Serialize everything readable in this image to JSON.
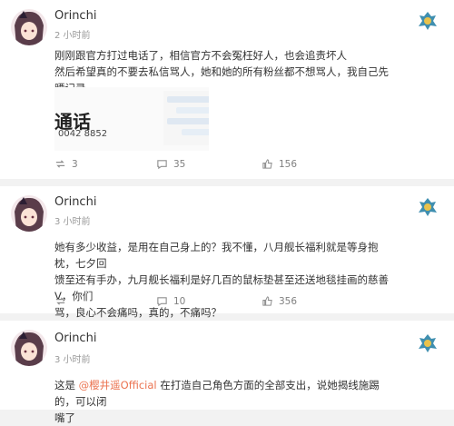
{
  "posts": [
    {
      "username": "Orinchi",
      "time": "2 小时前",
      "content": [
        "刚刚跟官方打过电话了，相信官方不会冤枉好人，也会追责坏人",
        "然后希望真的不要去私信骂人，她和她的所有粉丝都不想骂人，我自己先晒记录"
      ],
      "media": {
        "big_text": "通话",
        "phone_fragment": "0042 8852"
      },
      "actions": {
        "repost": "3",
        "comment": "35",
        "like": "156"
      }
    },
    {
      "username": "Orinchi",
      "time": "3 小时前",
      "content": [
        "她有多少收益，是用在自己身上的？我不懂，八月舰长福利就是等身抱枕，七夕回",
        "馈至还有手办，九月舰长福利是好几百的鼠标垫甚至还送地毯挂画的慈善V，你们",
        "骂，良心不会痛吗，真的，不痛吗？"
      ],
      "actions": {
        "repost": "",
        "comment": "10",
        "like": "356"
      }
    },
    {
      "username": "Orinchi",
      "time": "3 小时前",
      "content_prefix": "这是 ",
      "mention": "@樱井遥Official",
      "content_suffix": " 在打造自己角色方面的全部支出，说她揭线施踢的，可以闭",
      "content_line2": "嘴了"
    }
  ],
  "icons": {
    "repost": "repost-icon",
    "comment": "comment-icon",
    "like": "like-icon",
    "brand": "dragon-emblem-icon"
  },
  "colors": {
    "mention": "#eb7350",
    "muted": "#999999",
    "background": "#f2f2f2"
  }
}
